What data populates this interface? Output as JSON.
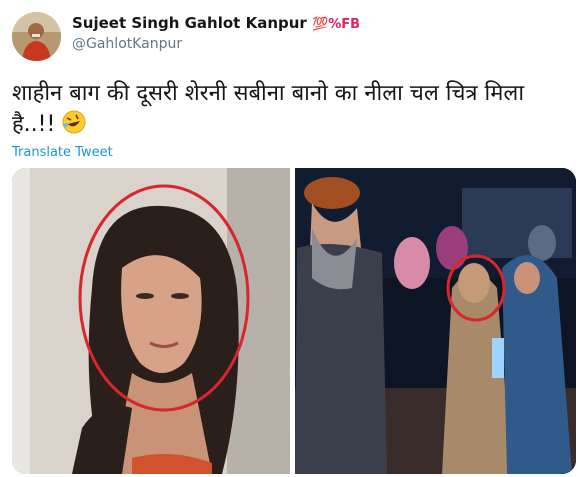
{
  "author": {
    "display_name": "Sujeet Singh Gahlot Kanpur",
    "badge": "💯%FB",
    "handle": "@GahlotKanpur"
  },
  "tweet": {
    "text": "शाहीन बाग की दूसरी शेरनी सबीना बानो का नीला चल चित्र मिला है..!!",
    "emoji": "rolling-on-floor-laughing-emoji"
  },
  "actions": {
    "translate": "Translate Tweet"
  },
  "media": {
    "left_photo": "woman-portrait-photo-circled",
    "right_photo": "crowd-photo-woman-circled"
  },
  "colors": {
    "link": "#1b95e0",
    "handle": "#657786",
    "badge": "#e0245e",
    "circle": "#d8262b"
  }
}
